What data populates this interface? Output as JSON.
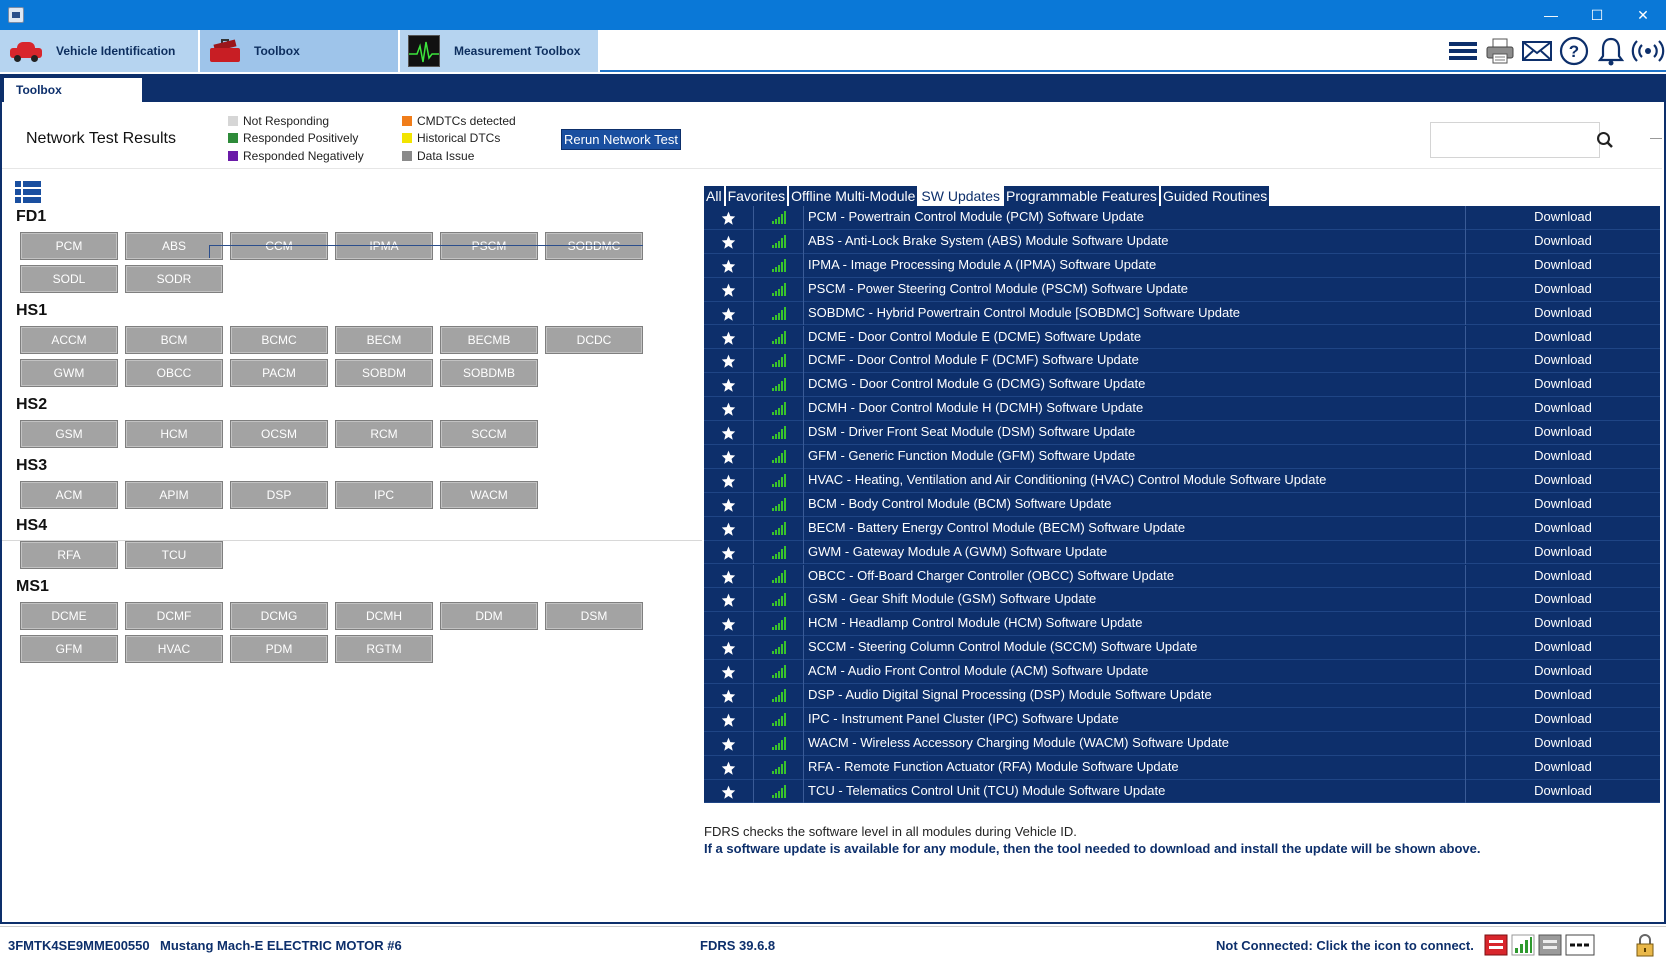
{
  "window": {
    "minimize": "—",
    "maximize": "☐",
    "close": "✕"
  },
  "app_tabs": [
    {
      "label": "Vehicle Identification"
    },
    {
      "label": "Toolbox"
    },
    {
      "label": "Measurement Toolbox"
    }
  ],
  "top_icons": [
    "menu-icon",
    "printer-icon",
    "mail-icon",
    "help-icon",
    "bell-icon",
    "wireless-icon"
  ],
  "sub_tabs": [
    {
      "label": "Toolbox"
    }
  ],
  "network_test": {
    "title": "Network Test Results",
    "rerun_label": "Rerun Network Test",
    "legend": [
      {
        "label": "Not Responding",
        "color": "#d6d6d6"
      },
      {
        "label": "Responded Positively",
        "color": "#2e8b3a"
      },
      {
        "label": "Responded Negatively",
        "color": "#6a1aa8"
      },
      {
        "label": "CMDTCs detected",
        "color": "#f07d1a"
      },
      {
        "label": "Historical DTCs",
        "color": "#f2e400"
      },
      {
        "label": "Data Issue",
        "color": "#8a8a8a"
      }
    ]
  },
  "search": {
    "placeholder": ""
  },
  "buses": [
    {
      "name": "FD1",
      "modules": [
        "PCM",
        "ABS",
        "CCM",
        "IPMA",
        "PSCM",
        "SOBDMC",
        "SODL",
        "SODR"
      ]
    },
    {
      "name": "HS1",
      "modules": [
        "ACCM",
        "BCM",
        "BCMC",
        "BECM",
        "BECMB",
        "DCDC",
        "GWM",
        "OBCC",
        "PACM",
        "SOBDM",
        "SOBDMB"
      ]
    },
    {
      "name": "HS2",
      "modules": [
        "GSM",
        "HCM",
        "OCSM",
        "RCM",
        "SCCM"
      ]
    },
    {
      "name": "HS3",
      "modules": [
        "ACM",
        "APIM",
        "DSP",
        "IPC",
        "WACM"
      ]
    },
    {
      "name": "HS4",
      "modules": [
        "RFA",
        "TCU"
      ]
    },
    {
      "name": "MS1",
      "modules": [
        "DCME",
        "DCMF",
        "DCMG",
        "DCMH",
        "DDM",
        "DSM",
        "GFM",
        "HVAC",
        "PDM",
        "RGTM"
      ]
    }
  ],
  "filter_tabs": [
    {
      "label": "All",
      "active": false
    },
    {
      "label": "Favorites",
      "active": false
    },
    {
      "label": "Offline Multi-Module",
      "active": false
    },
    {
      "label": "SW Updates",
      "active": true
    },
    {
      "label": "Programmable Features",
      "active": false
    },
    {
      "label": "Guided Routines",
      "active": false
    }
  ],
  "updates": [
    {
      "name": "PCM - Powertrain Control Module (PCM) Software Update",
      "action": "Download"
    },
    {
      "name": "ABS - Anti-Lock Brake System (ABS) Module Software Update",
      "action": "Download"
    },
    {
      "name": "IPMA - Image Processing Module A (IPMA) Software Update",
      "action": "Download"
    },
    {
      "name": "PSCM - Power Steering Control Module (PSCM) Software Update",
      "action": "Download"
    },
    {
      "name": "SOBDMC - Hybrid Powertrain Control Module [SOBDMC] Software Update",
      "action": "Download"
    },
    {
      "name": "DCME - Door Control Module E (DCME) Software Update",
      "action": "Download"
    },
    {
      "name": "DCMF - Door Control Module F (DCMF) Software Update",
      "action": "Download"
    },
    {
      "name": "DCMG - Door Control Module G (DCMG) Software Update",
      "action": "Download"
    },
    {
      "name": "DCMH - Door Control Module H (DCMH) Software Update",
      "action": "Download"
    },
    {
      "name": "DSM - Driver Front Seat Module (DSM) Software Update",
      "action": "Download"
    },
    {
      "name": "GFM - Generic Function Module (GFM) Software Update",
      "action": "Download"
    },
    {
      "name": "HVAC - Heating, Ventilation and Air Conditioning (HVAC) Control Module Software Update",
      "action": "Download"
    },
    {
      "name": "BCM - Body Control Module (BCM) Software Update",
      "action": "Download"
    },
    {
      "name": "BECM - Battery Energy Control Module (BECM) Software Update",
      "action": "Download"
    },
    {
      "name": "GWM - Gateway Module A (GWM) Software Update",
      "action": "Download"
    },
    {
      "name": "OBCC - Off-Board Charger Controller (OBCC) Software Update",
      "action": "Download"
    },
    {
      "name": "GSM - Gear Shift Module (GSM) Software Update",
      "action": "Download"
    },
    {
      "name": "HCM - Headlamp Control Module (HCM) Software Update",
      "action": "Download"
    },
    {
      "name": "SCCM - Steering Column Control Module (SCCM) Software Update",
      "action": "Download"
    },
    {
      "name": "ACM - Audio Front Control Module (ACM) Software Update",
      "action": "Download"
    },
    {
      "name": "DSP - Audio Digital Signal Processing (DSP) Module Software Update",
      "action": "Download"
    },
    {
      "name": "IPC - Instrument Panel Cluster (IPC) Software Update",
      "action": "Download"
    },
    {
      "name": "WACM - Wireless Accessory Charging Module (WACM) Software Update",
      "action": "Download"
    },
    {
      "name": "RFA - Remote Function Actuator (RFA) Module Software Update",
      "action": "Download"
    },
    {
      "name": "TCU - Telematics Control Unit (TCU) Module Software Update",
      "action": "Download"
    }
  ],
  "notes": {
    "line1": "FDRS checks the software level in all modules during Vehicle ID.",
    "line2": "If a software update is available for any module, then the tool needed to download and install the update will be shown above."
  },
  "status": {
    "vin": "3FMTK4SE9MME00550",
    "vehicle": "Mustang Mach-E ELECTRIC MOTOR #6",
    "version": "FDRS 39.6.8",
    "connection": "Not Connected: Click the icon to connect."
  },
  "status_icons": [
    "vci-red-icon",
    "signal-green-icon",
    "vci-gray-icon",
    "cable-icon",
    "lock-icon"
  ],
  "colors": {
    "navy": "#0d2f6b",
    "titlebar": "#0a78d7",
    "module_gray": "#a3a3a3",
    "signal_green": "#39c42b"
  }
}
